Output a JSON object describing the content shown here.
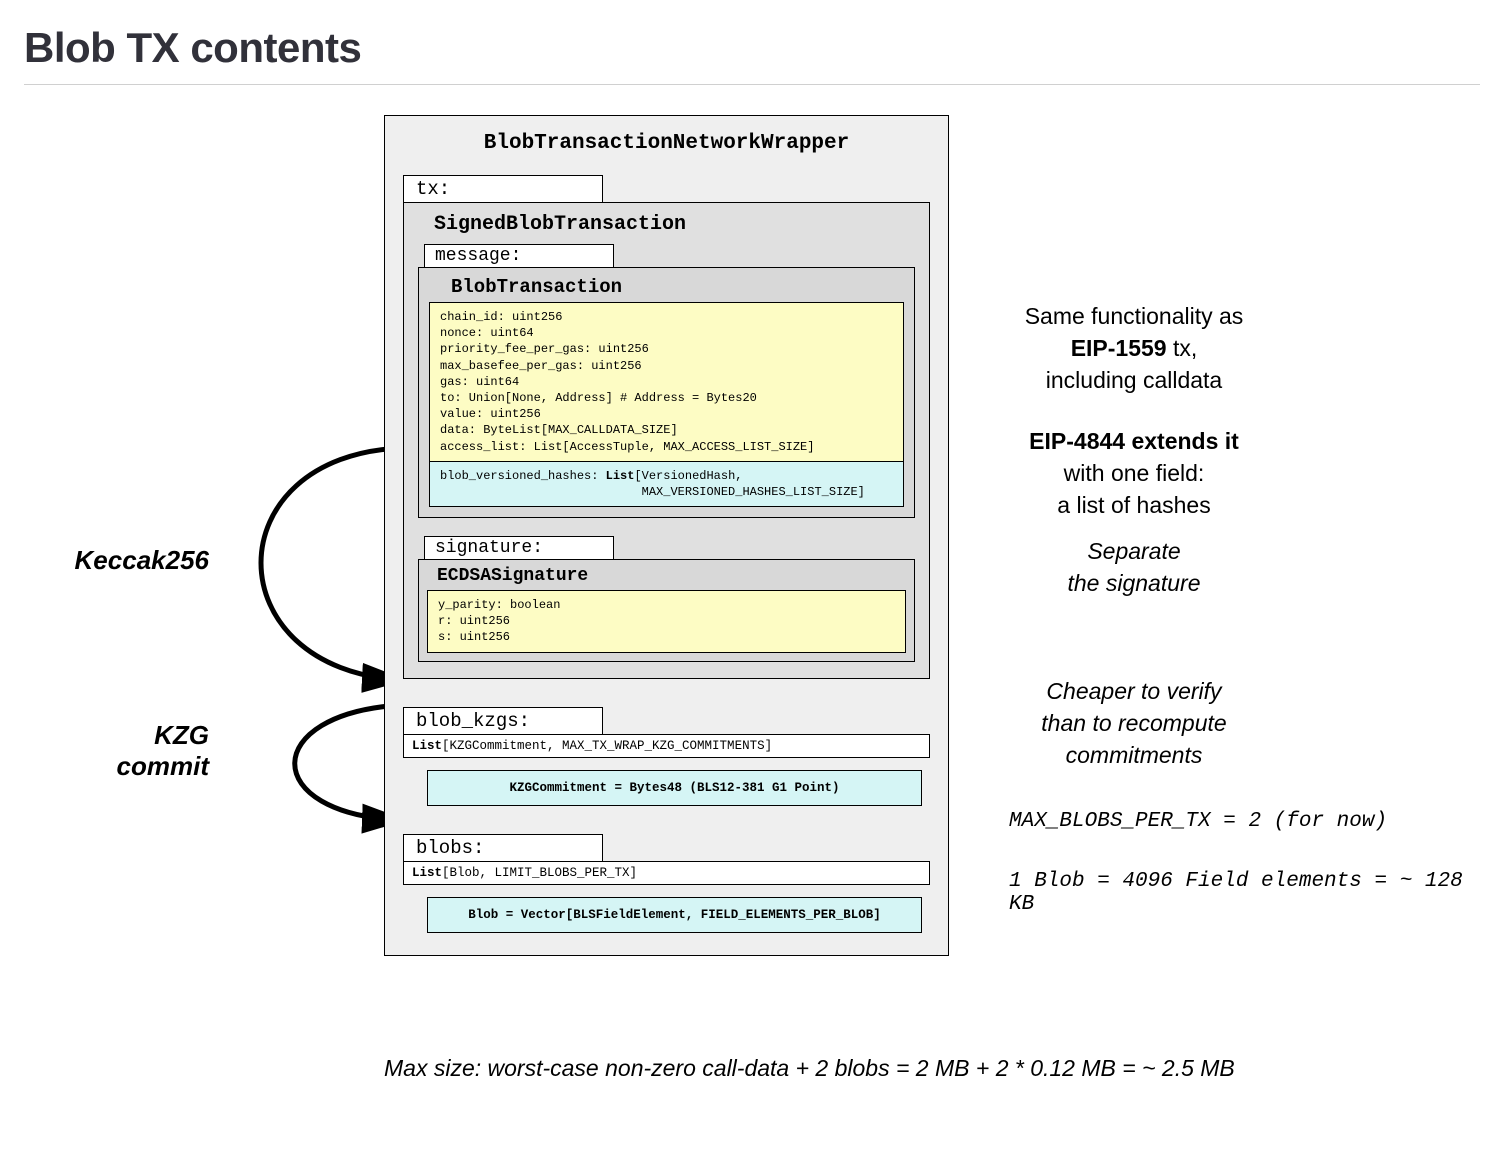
{
  "title": "Blob TX contents",
  "wrapper": {
    "title": "BlobTransactionNetworkWrapper",
    "tx_label": "tx:",
    "signed": {
      "title": "SignedBlobTransaction",
      "message_label": "message:",
      "blobtx": {
        "title": "BlobTransaction",
        "fields": "chain_id: uint256\nnonce: uint64\npriority_fee_per_gas: uint256\nmax_basefee_per_gas: uint256\ngas: uint64\nto: Union[None, Address] # Address = Bytes20\nvalue: uint256\ndata: ByteList[MAX_CALLDATA_SIZE]\naccess_list: List[AccessTuple, MAX_ACCESS_LIST_SIZE]",
        "blob_hashes": "blob_versioned_hashes: List[VersionedHash,\n                            MAX_VERSIONED_HASHES_LIST_SIZE]"
      },
      "signature_label": "signature:",
      "ecdsa": {
        "title": "ECDSASignature",
        "fields": "y_parity: boolean\nr: uint256\ns: uint256"
      }
    },
    "blob_kzgs_label": "blob_kzgs:",
    "blob_kzgs_list": "List[KZGCommitment, MAX_TX_WRAP_KZG_COMMITMENTS]",
    "kzg_commitment": "KZGCommitment = Bytes48  (BLS12-381 G1 Point)",
    "blobs_label": "blobs:",
    "blobs_list": "List[Blob, LIMIT_BLOBS_PER_TX]",
    "blob_def": "Blob = Vector[BLSFieldElement, FIELD_ELEMENTS_PER_BLOB]"
  },
  "left": {
    "keccak": "Keccak256",
    "kzg": "KZG\ncommit"
  },
  "right": {
    "note1_a": "Same functionality as",
    "note1_b": "EIP-1559",
    "note1_c": " tx,",
    "note1_d": "including calldata",
    "note2_a": "EIP-4844 extends it",
    "note2_b": "with one field:",
    "note2_c": "a list of hashes",
    "note3_a": "Separate",
    "note3_b": "the signature",
    "note4_a": "Cheaper to verify",
    "note4_b": "than to recompute",
    "note4_c": "commitments",
    "note5": "MAX_BLOBS_PER_TX = 2 (for now)",
    "note6": "1 Blob = 4096 Field elements = ~ 128 KB"
  },
  "bottom": "Max size: worst-case non-zero call-data + 2 blobs = 2 MB + 2 * 0.12 MB = ~ 2.5 MB"
}
